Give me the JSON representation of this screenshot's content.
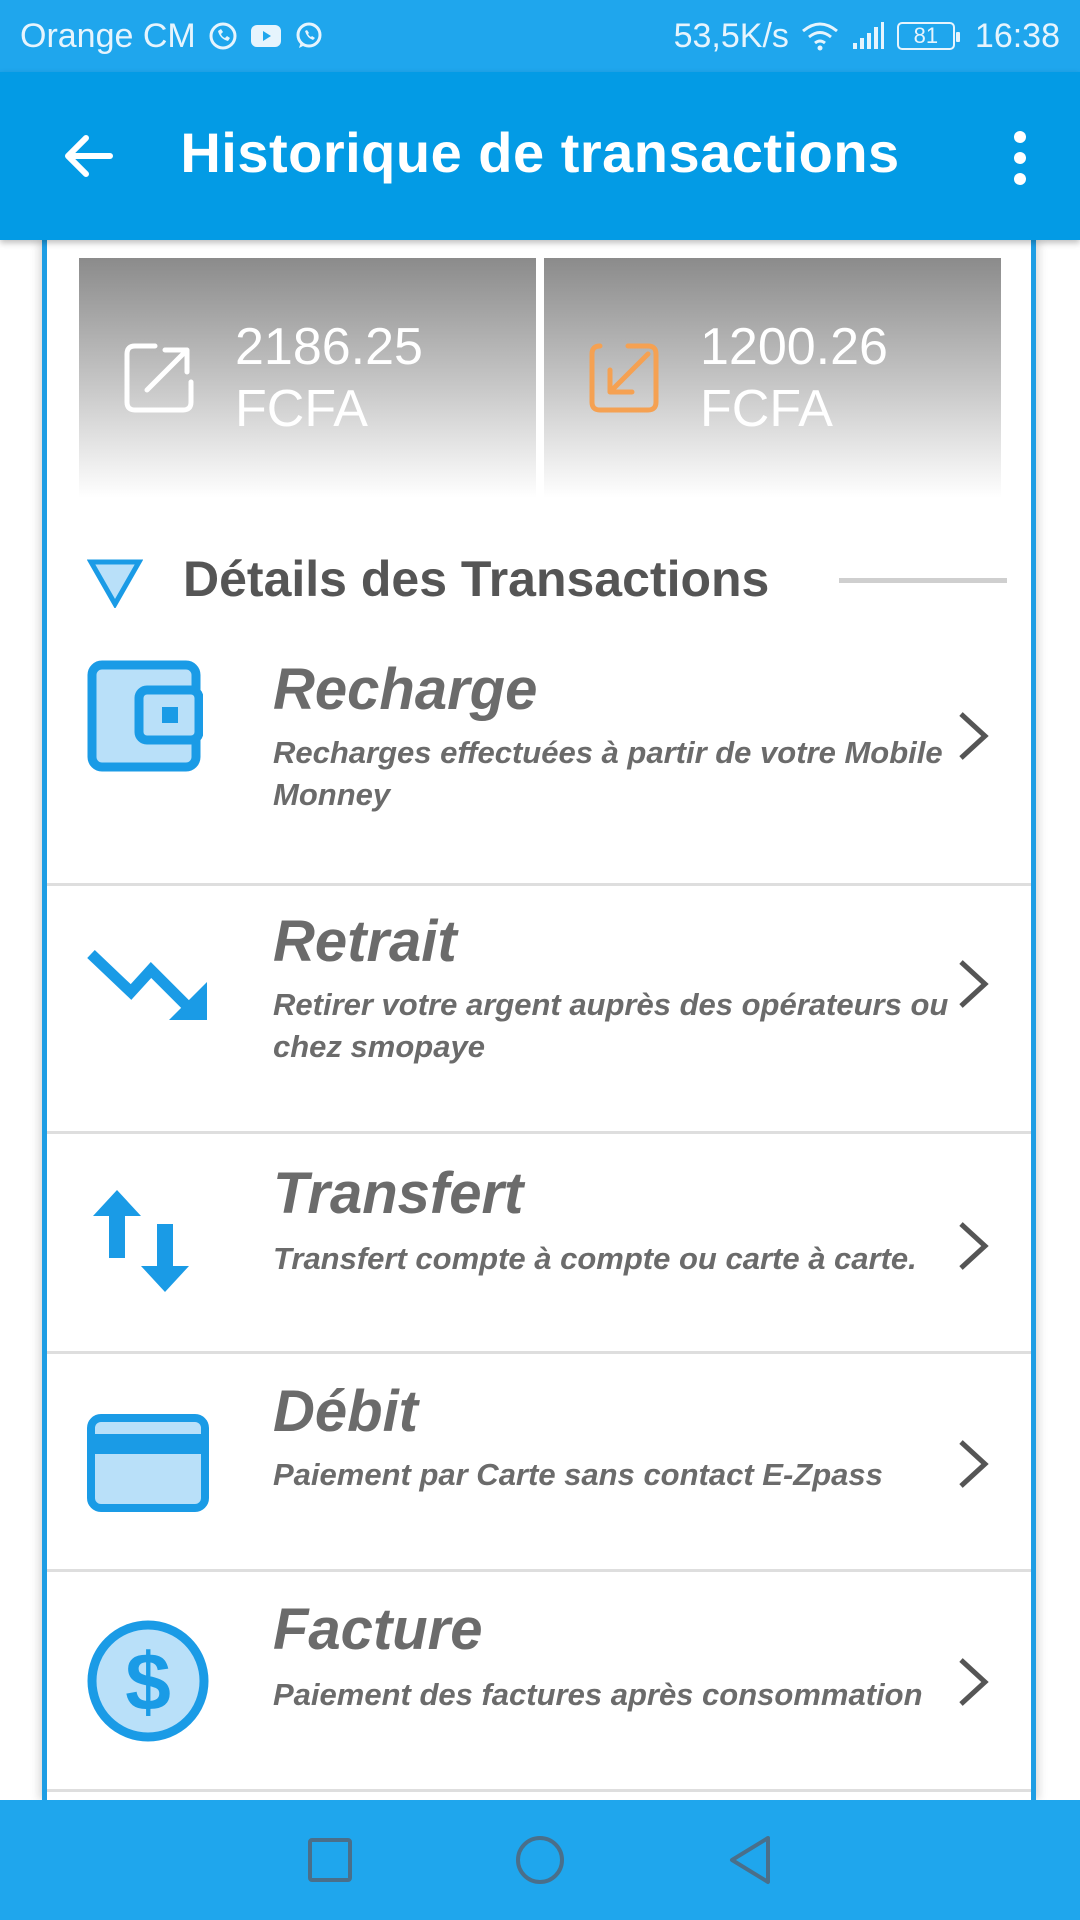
{
  "status_bar": {
    "carrier": "Orange CM",
    "speed": "53,5K/s",
    "battery": "81",
    "time": "16:38",
    "icons": [
      "whatsapp-call-icon",
      "youtube-icon",
      "whatsapp-icon",
      "wifi-icon",
      "signal-icon",
      "battery-icon"
    ]
  },
  "app_bar": {
    "title": "Historique de transactions",
    "back_icon": "arrow-back-icon",
    "menu_icon": "more-vert-icon"
  },
  "summary": {
    "outgoing": {
      "amount": "2186.25",
      "currency": "FCFA",
      "icon": "outgoing-arrow-icon"
    },
    "incoming": {
      "amount": "1200.26",
      "currency": "FCFA",
      "icon": "incoming-arrow-icon"
    }
  },
  "section": {
    "title": "Détails des Transactions"
  },
  "transactions": [
    {
      "title": "Recharge",
      "desc_line1": "Recharges effectuées à partir de votre Mobile",
      "desc_line2": "Monney",
      "icon": "wallet-icon"
    },
    {
      "title": "Retrait",
      "desc_line1": "Retirer votre argent auprès des opérateurs ou",
      "desc_line2": "chez smopaye",
      "icon": "trending-down-icon"
    },
    {
      "title": "Transfert",
      "desc_line1": "Transfert compte à compte ou carte à carte.",
      "desc_line2": "",
      "icon": "swap-vertical-icon"
    },
    {
      "title": "Débit",
      "desc_line1": "Paiement par Carte sans contact E-Zpass",
      "desc_line2": "",
      "icon": "credit-card-icon"
    },
    {
      "title": "Facture",
      "desc_line1": "Paiement des factures après consommation",
      "desc_line2": "",
      "icon": "dollar-circle-icon"
    }
  ],
  "colors": {
    "primary": "#039be5",
    "status_bar": "#1fa6ed",
    "icon_blue": "#1a9be6",
    "icon_light": "#b9e0f9",
    "incoming_orange": "#f5a152",
    "text_gray": "#6b6b6b"
  },
  "nav_bar": {
    "icons": [
      "recent-apps-icon",
      "home-icon",
      "back-icon"
    ]
  }
}
